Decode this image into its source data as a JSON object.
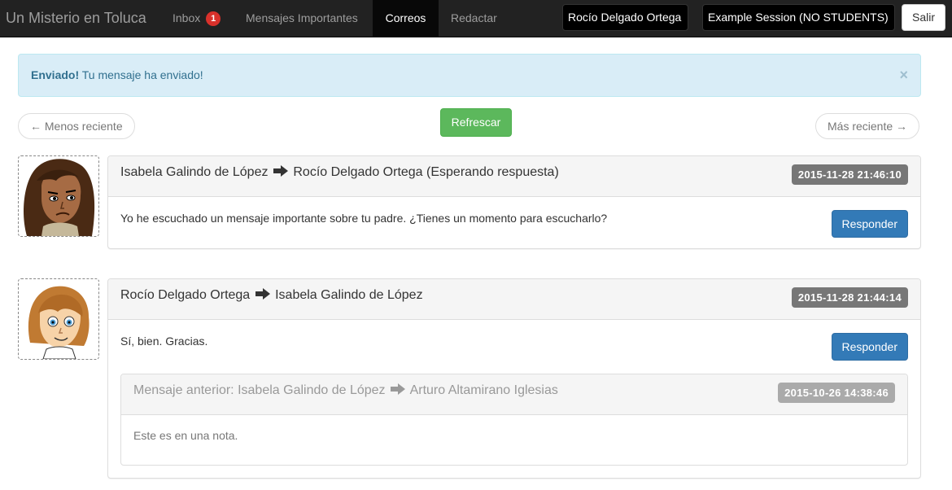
{
  "navbar": {
    "brand": "Un Misterio en Toluca",
    "inbox_label": "Inbox",
    "inbox_count": "1",
    "important_label": "Mensajes Importantes",
    "mail_label": "Correos",
    "compose_label": "Redactar",
    "user_name": "Rocío Delgado Ortega",
    "session_name": "Example Session (NO STUDENTS)",
    "logout_label": "Salir"
  },
  "alert": {
    "strong": "Enviado!",
    "text": "Tu mensaje ha enviado!",
    "close": "×"
  },
  "pager": {
    "older": "← Menos reciente",
    "refresh": "Refrescar",
    "newer": "Más reciente →"
  },
  "messages": [
    {
      "from": "Isabela Galindo de López",
      "to": "Rocío Delgado Ortega (Esperando respuesta)",
      "date": "2015-11-28 21:46:10",
      "body": "Yo he escuchado un mensaje importante sobre tu padre. ¿Tienes un momento para escucharlo?",
      "reply": "Responder"
    },
    {
      "from": "Rocío Delgado Ortega",
      "to": "Isabela Galindo de López",
      "date": "2015-11-28 21:44:14",
      "body": "Sí, bien. Gracias.",
      "reply": "Responder",
      "previous": {
        "prefix": "Mensaje anterior:",
        "from": "Isabela Galindo de López",
        "to": "Arturo Altamirano Iglesias",
        "date": "2015-10-26 14:38:46",
        "body": "Este es en una nota."
      }
    }
  ],
  "colors": {
    "navbar": "#222222",
    "alert_bg": "#d9edf7",
    "success": "#5cb85c",
    "primary": "#337ab7",
    "badge_red": "#d9312b"
  }
}
